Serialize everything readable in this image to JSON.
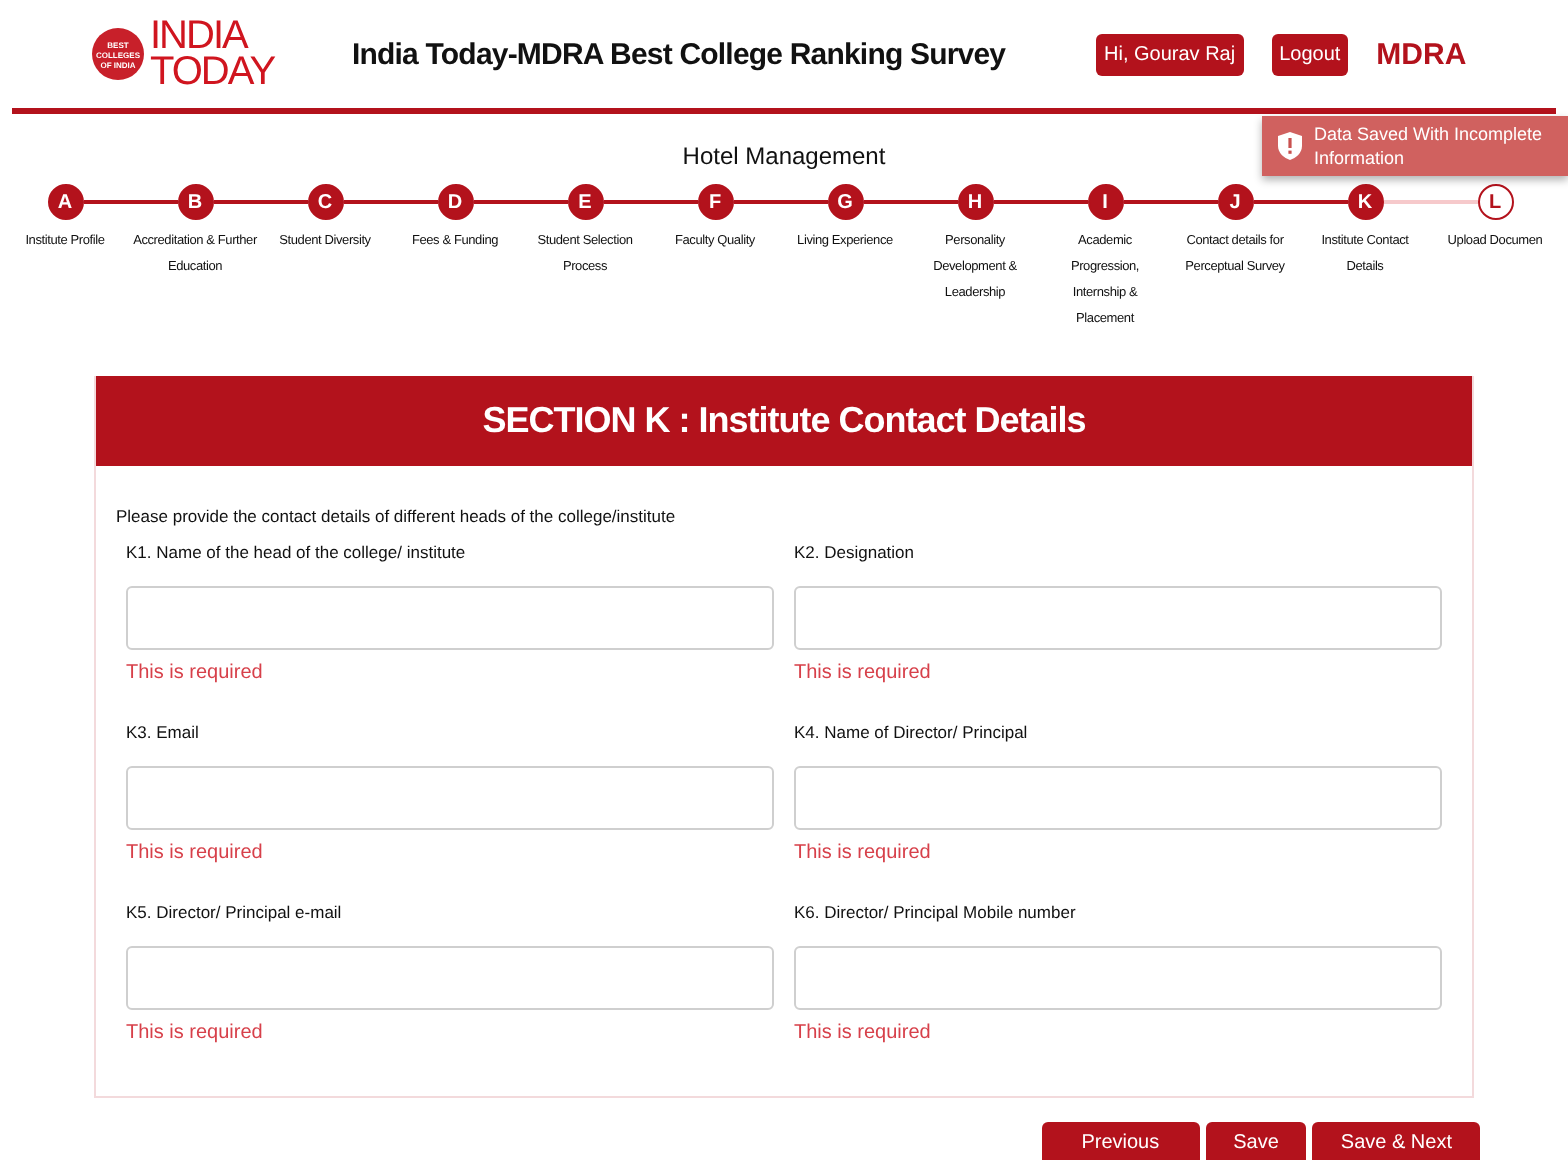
{
  "header": {
    "logo": {
      "badge": "BEST COLLEGES OF INDIA",
      "line1": "INDIA",
      "line2": "TODAY"
    },
    "title": "India Today-MDRA Best College Ranking Survey",
    "user_button": "Hi, Gourav Raj",
    "logout_button": "Logout",
    "partner_logo": "MDRA"
  },
  "toast": {
    "message": "Data Saved With Incomplete Information"
  },
  "stream": "Hotel Management",
  "steps": [
    {
      "letter": "A",
      "label": "Institute Profile",
      "completed": true
    },
    {
      "letter": "B",
      "label": "Accreditation & Further Education",
      "completed": true
    },
    {
      "letter": "C",
      "label": "Student Diversity",
      "completed": true
    },
    {
      "letter": "D",
      "label": "Fees & Funding",
      "completed": true
    },
    {
      "letter": "E",
      "label": "Student Selection Process",
      "completed": true
    },
    {
      "letter": "F",
      "label": "Faculty Quality",
      "completed": true
    },
    {
      "letter": "G",
      "label": "Living Experience",
      "completed": true
    },
    {
      "letter": "H",
      "label": "Personality Development & Leadership",
      "completed": true
    },
    {
      "letter": "I",
      "label": "Academic Progression, Internship & Placement",
      "completed": true
    },
    {
      "letter": "J",
      "label": "Contact details for Perceptual Survey",
      "completed": true
    },
    {
      "letter": "K",
      "label": "Institute Contact Details",
      "completed": true
    },
    {
      "letter": "L",
      "label": "Upload Documen",
      "completed": false
    }
  ],
  "section": {
    "title": "SECTION K : Institute Contact Details",
    "intro": "Please provide the contact details of different heads of the college/institute",
    "fields": [
      {
        "label": "K1. Name of the head of the college/ institute",
        "error": "This is required"
      },
      {
        "label": "K2. Designation",
        "error": "This is required"
      },
      {
        "label": "K3. Email",
        "error": "This is required"
      },
      {
        "label": "K4. Name of Director/ Principal",
        "error": "This is required"
      },
      {
        "label": "K5. Director/ Principal e-mail",
        "error": "This is required"
      },
      {
        "label": "K6. Director/ Principal Mobile number",
        "error": "This is required"
      }
    ]
  },
  "buttons": [
    "Previous",
    "Save",
    "Save & Next"
  ]
}
